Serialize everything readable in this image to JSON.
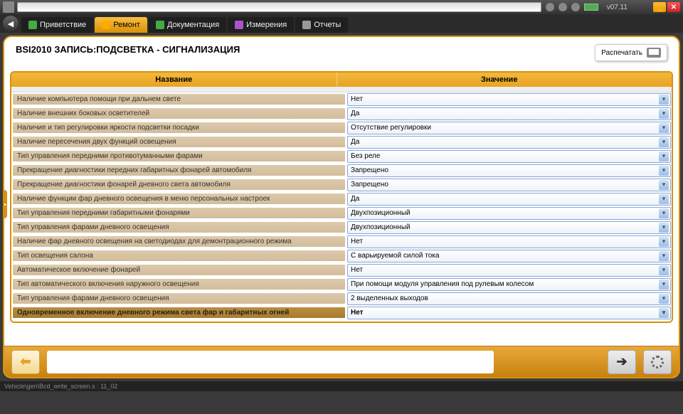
{
  "titlebar": {
    "version": "v07.11"
  },
  "tabs": [
    {
      "label": "Приветствие"
    },
    {
      "label": "Ремонт"
    },
    {
      "label": "Документация"
    },
    {
      "label": "Измерения"
    },
    {
      "label": "Отчеты"
    }
  ],
  "page_title": "BSI2010  ЗАПИСЬ:ПОДСВЕТКА - СИГНАЛИЗАЦИЯ",
  "print_label": "Распечатать",
  "col_name": "Название",
  "col_value": "Значение",
  "rows": [
    {
      "name": "Наличие компьютера помощи при дальнем свете",
      "value": "Нет"
    },
    {
      "name": "Наличие внешних боковых осветителей",
      "value": "Да"
    },
    {
      "name": "Наличие и тип регулировки яркости подсветки посадки",
      "value": "Отсутствие регулировки"
    },
    {
      "name": "Наличие пересечения двух функций освещения",
      "value": "Да"
    },
    {
      "name": "Тип управления передними противотуманными фарами",
      "value": "Без реле"
    },
    {
      "name": "Прекращение диагностики передних габаритных фонарей автомобиля",
      "value": "Запрещено"
    },
    {
      "name": "Прекращение диагностики фонарей дневного света автомобиля",
      "value": "Запрещено"
    },
    {
      "name": "Наличие функции фар дневного освещения в меню персональных настроек",
      "value": "Да"
    },
    {
      "name": "Тип управления передними габаритными фонарями",
      "value": "Двухпозиционный"
    },
    {
      "name": "Тип управления фарами дневного освещения",
      "value": "Двухпозиционный"
    },
    {
      "name": "Наличие фар дневного освещения на светодиодах для демонтрационного режима",
      "value": "Нет"
    },
    {
      "name": "Тип освещения салона",
      "value": "С варьируемой силой тока"
    },
    {
      "name": "Автоматическое включение фонарей",
      "value": "Нет"
    },
    {
      "name": "Тип автоматического включения наружного освещения",
      "value": "При помощи модуля управления под рулевым колесом"
    },
    {
      "name": "Тип управления фарами дневного освещения",
      "value": "2 выделенных выходов"
    },
    {
      "name": "Одновременное включение дневного режима света фар и габаритных огней",
      "value": "Нет",
      "highlight": true
    }
  ],
  "status": "Vehicle\\gen\\Bcd_write_screen.s : 11_02"
}
